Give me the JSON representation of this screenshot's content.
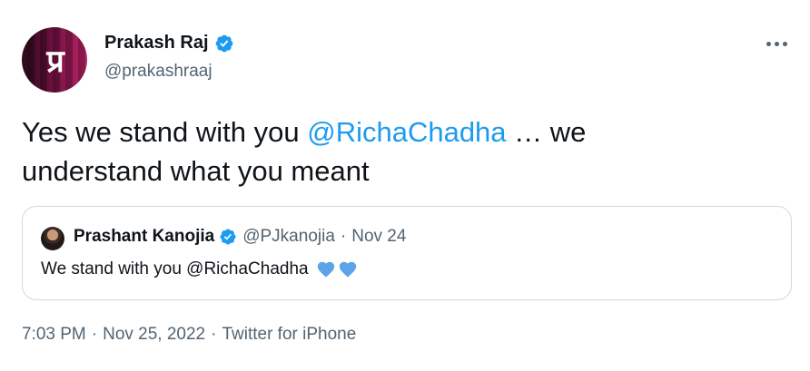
{
  "author": {
    "display_name": "Prakash Raj",
    "handle": "@prakashraaj",
    "avatar_monogram": "प्र"
  },
  "tweet": {
    "text_before": "Yes we stand with you ",
    "mention": "@RichaChadha",
    "text_after": " … we understand what you meant"
  },
  "quoted": {
    "display_name": "Prashant Kanojia",
    "handle": "@PJkanojia",
    "separator": "·",
    "date": "Nov 24",
    "text": "We stand with you @RichaChadha"
  },
  "meta": {
    "time": "7:03 PM",
    "separator": "·",
    "date": "Nov 25, 2022",
    "source": "Twitter for iPhone"
  },
  "colors": {
    "accent": "#1d9bf0",
    "text": "#0f1419",
    "secondary": "#536471",
    "heart": "#5ba4e8"
  },
  "icons": {
    "verified": "verified-badge-icon",
    "more": "more-options-icon",
    "heart": "blue-heart-icon"
  }
}
